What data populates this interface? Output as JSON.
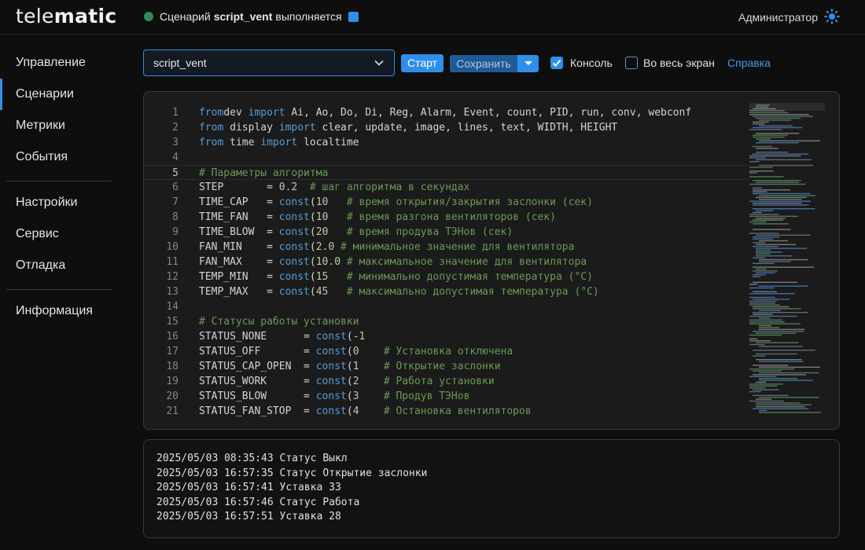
{
  "header": {
    "logo_light": "tele",
    "logo_bold": "matic",
    "status_prefix": "Сценарий",
    "status_script": "script_vent",
    "status_suffix": "выполняется",
    "user": "Администратор",
    "status_dot_color": "#2e8b57",
    "accent_color": "#2f8fe8"
  },
  "sidebar": {
    "items": [
      {
        "label": "Управление"
      },
      {
        "label": "Сценарии"
      },
      {
        "label": "Метрики"
      },
      {
        "label": "События"
      },
      {
        "label": "Настройки"
      },
      {
        "label": "Сервис"
      },
      {
        "label": "Отладка"
      },
      {
        "label": "Информация"
      }
    ],
    "active": "Сценарии"
  },
  "toolbar": {
    "script_select": "script_vent",
    "start_label": "Старт",
    "save_label": "Сохранить",
    "console_label": "Консоль",
    "console_checked": true,
    "fullscreen_label": "Во весь экран",
    "fullscreen_checked": false,
    "help_label": "Справка"
  },
  "editor": {
    "current_line": 5,
    "lines": [
      {
        "n": "1",
        "code": [
          [
            "kw",
            "from"
          ],
          [
            "",
            "dev"
          ],
          [
            "kw",
            " import"
          ],
          [
            "",
            " Ai, Ao, Do, Di, Reg, Alarm, Event, count, PID, run, conv, webconf"
          ]
        ]
      },
      {
        "n": "2",
        "code": [
          [
            "kw",
            "from"
          ],
          [
            "",
            " display"
          ],
          [
            "kw",
            " import"
          ],
          [
            "",
            " clear, update, image, lines, text, WIDTH, HEIGHT"
          ]
        ]
      },
      {
        "n": "3",
        "code": [
          [
            "kw",
            "from"
          ],
          [
            "",
            " time"
          ],
          [
            "kw",
            " import"
          ],
          [
            "",
            " localtime"
          ]
        ]
      },
      {
        "n": "4",
        "code": []
      },
      {
        "n": "5",
        "code": [
          [
            "cm",
            "# Параметры алгоритма"
          ]
        ]
      },
      {
        "n": "6",
        "code": [
          [
            "",
            "STEP       = "
          ],
          [
            "num",
            "0.2"
          ],
          [
            "cm",
            "  # шаг алгоритма в секундах"
          ]
        ]
      },
      {
        "n": "7",
        "code": [
          [
            "",
            "TIME_CAP   = "
          ],
          [
            "kw",
            "const"
          ],
          [
            "",
            "("
          ],
          [
            "num",
            "10"
          ],
          [
            ")"
          ],
          [
            "cm",
            "   # время открытия/закрытия заслонки (сек)"
          ]
        ]
      },
      {
        "n": "8",
        "code": [
          [
            "",
            "TIME_FAN   = "
          ],
          [
            "kw",
            "const"
          ],
          [
            "",
            "("
          ],
          [
            "num",
            "10"
          ],
          [
            ")"
          ],
          [
            "cm",
            "   # время разгона вентиляторов (сек)"
          ]
        ]
      },
      {
        "n": "9",
        "code": [
          [
            "",
            "TIME_BLOW  = "
          ],
          [
            "kw",
            "const"
          ],
          [
            "",
            "("
          ],
          [
            "num",
            "20"
          ],
          [
            ")"
          ],
          [
            "cm",
            "   # время продува ТЭНов (сек)"
          ]
        ]
      },
      {
        "n": "10",
        "code": [
          [
            "",
            "FAN_MIN    = "
          ],
          [
            "kw",
            "const"
          ],
          [
            "",
            "("
          ],
          [
            "num",
            "2.0"
          ],
          [
            ")"
          ],
          [
            "cm",
            " # минимальное значение для вентилятора"
          ]
        ]
      },
      {
        "n": "11",
        "code": [
          [
            "",
            "FAN_MAX    = "
          ],
          [
            "kw",
            "const"
          ],
          [
            "",
            "("
          ],
          [
            "num",
            "10.0"
          ],
          [
            ")"
          ],
          [
            "cm",
            " # максимальное значение для вентилятора"
          ]
        ]
      },
      {
        "n": "12",
        "code": [
          [
            "",
            "TEMP_MIN   = "
          ],
          [
            "kw",
            "const"
          ],
          [
            "",
            "("
          ],
          [
            "num",
            "15"
          ],
          [
            ")"
          ],
          [
            "cm",
            "   # минимально допустимая температура (°C)"
          ]
        ]
      },
      {
        "n": "13",
        "code": [
          [
            "",
            "TEMP_MAX   = "
          ],
          [
            "kw",
            "const"
          ],
          [
            "",
            "("
          ],
          [
            "num",
            "45"
          ],
          [
            ")"
          ],
          [
            "cm",
            "   # максимально допустимая температура (°C)"
          ]
        ]
      },
      {
        "n": "14",
        "code": []
      },
      {
        "n": "15",
        "code": [
          [
            "cm",
            "# Статусы работы установки"
          ]
        ]
      },
      {
        "n": "16",
        "code": [
          [
            "",
            "STATUS_NONE      = "
          ],
          [
            "kw",
            "const"
          ],
          [
            "",
            "("
          ],
          [
            "num",
            "-1"
          ],
          [
            ")"
          ]
        ]
      },
      {
        "n": "17",
        "code": [
          [
            "",
            "STATUS_OFF       = "
          ],
          [
            "kw",
            "const"
          ],
          [
            "",
            "("
          ],
          [
            "num",
            "0"
          ],
          [
            ")"
          ],
          [
            "cm",
            "    # Установка отключена"
          ]
        ]
      },
      {
        "n": "18",
        "code": [
          [
            "",
            "STATUS_CAP_OPEN  = "
          ],
          [
            "kw",
            "const"
          ],
          [
            "",
            "("
          ],
          [
            "num",
            "1"
          ],
          [
            ")"
          ],
          [
            "cm",
            "    # Открытие заслонки"
          ]
        ]
      },
      {
        "n": "19",
        "code": [
          [
            "",
            "STATUS_WORK      = "
          ],
          [
            "kw",
            "const"
          ],
          [
            "",
            "("
          ],
          [
            "num",
            "2"
          ],
          [
            ")"
          ],
          [
            "cm",
            "    # Работа установки"
          ]
        ]
      },
      {
        "n": "20",
        "code": [
          [
            "",
            "STATUS_BLOW      = "
          ],
          [
            "kw",
            "const"
          ],
          [
            "",
            "("
          ],
          [
            "num",
            "3"
          ],
          [
            ")"
          ],
          [
            "cm",
            "    # Продув ТЭНов"
          ]
        ]
      },
      {
        "n": "21",
        "code": [
          [
            "",
            "STATUS_FAN_STOP  = "
          ],
          [
            "kw",
            "const"
          ],
          [
            "",
            "("
          ],
          [
            "num",
            "4"
          ],
          [
            ")"
          ],
          [
            "cm",
            "    # Остановка вентиляторов"
          ]
        ]
      }
    ]
  },
  "console": {
    "lines": [
      "2025/05/03 08:35:43 Статус Выкл",
      "2025/05/03 16:57:35 Статус Открытие заслонки",
      "2025/05/03 16:57:41 Уставка 33",
      "2025/05/03 16:57:46 Статус Работа",
      "2025/05/03 16:57:51 Уставка 28"
    ]
  }
}
